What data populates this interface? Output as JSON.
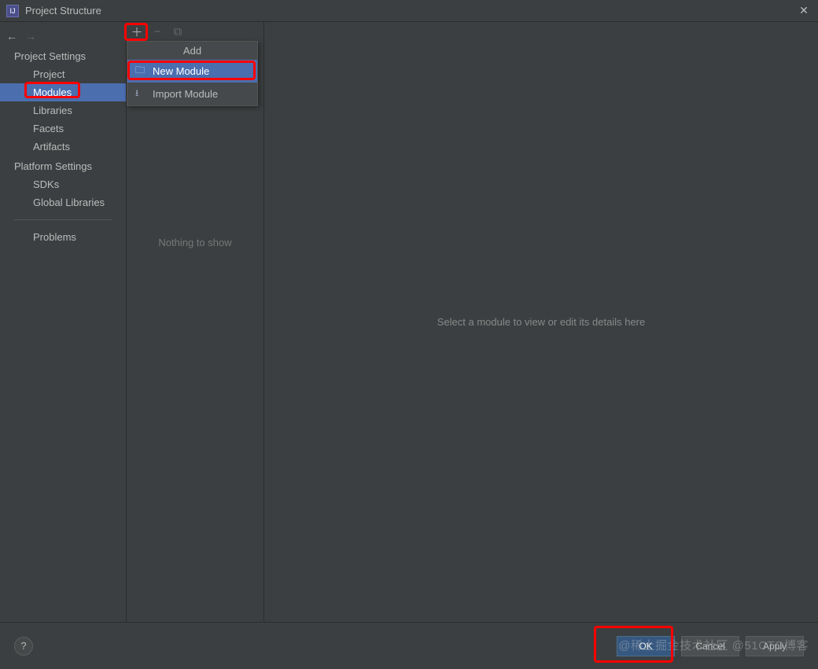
{
  "window": {
    "title": "Project Structure",
    "app_icon_text": "IJ"
  },
  "sidebar": {
    "section1": "Project Settings",
    "items1": [
      "Project",
      "Modules",
      "Libraries",
      "Facets",
      "Artifacts"
    ],
    "selected1": 1,
    "section2": "Platform Settings",
    "items2": [
      "SDKs",
      "Global Libraries"
    ],
    "section3_item": "Problems"
  },
  "module_column": {
    "empty_text": "Nothing to show"
  },
  "popup": {
    "header": "Add",
    "items": [
      {
        "icon": "folder-icon",
        "label": "New Module",
        "selected": true
      },
      {
        "icon": "import-icon",
        "label": "Import Module",
        "selected": false
      }
    ]
  },
  "detail": {
    "placeholder": "Select a module to view or edit its details here"
  },
  "footer": {
    "help": "?",
    "ok": "OK",
    "cancel": "Cancel",
    "apply": "Apply"
  },
  "watermark": "@稀土掘金技术社区  @51CTO博客"
}
